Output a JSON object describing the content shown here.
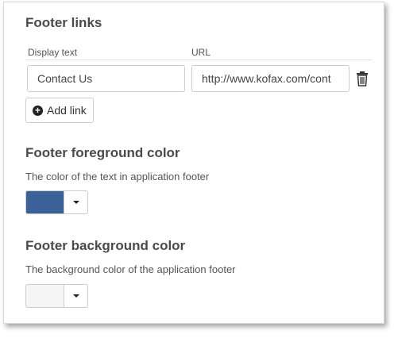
{
  "footer_links": {
    "title": "Footer links",
    "col_display": "Display text",
    "col_url": "URL",
    "rows": [
      {
        "display_text": "Contact Us",
        "url": "http://www.kofax.com/cont"
      }
    ],
    "add_label": "Add link"
  },
  "foreground": {
    "title": "Footer foreground color",
    "description": "The color of the text in application footer",
    "color": "#3a6298"
  },
  "background": {
    "title": "Footer background color",
    "description": "The background color of the application footer",
    "color": "#f5f5f5"
  }
}
